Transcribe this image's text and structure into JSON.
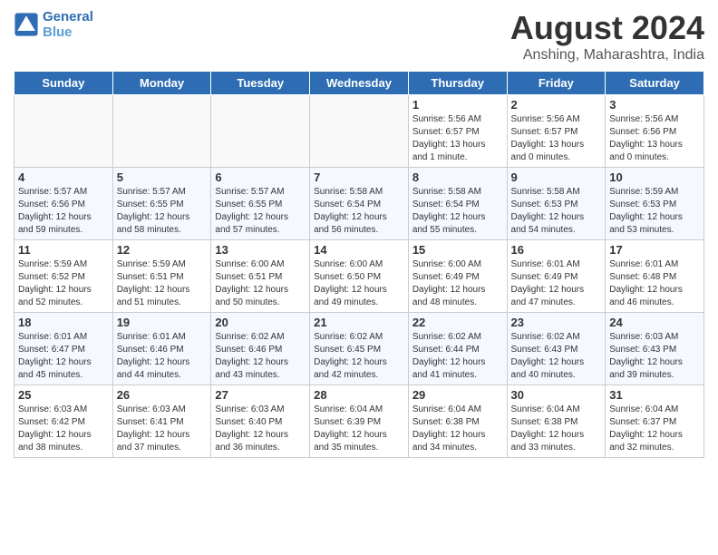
{
  "header": {
    "logo_line1": "General",
    "logo_line2": "Blue",
    "main_title": "August 2024",
    "subtitle": "Anshing, Maharashtra, India"
  },
  "weekdays": [
    "Sunday",
    "Monday",
    "Tuesday",
    "Wednesday",
    "Thursday",
    "Friday",
    "Saturday"
  ],
  "weeks": [
    [
      {
        "day": "",
        "info": ""
      },
      {
        "day": "",
        "info": ""
      },
      {
        "day": "",
        "info": ""
      },
      {
        "day": "",
        "info": ""
      },
      {
        "day": "1",
        "info": "Sunrise: 5:56 AM\nSunset: 6:57 PM\nDaylight: 13 hours\nand 1 minute."
      },
      {
        "day": "2",
        "info": "Sunrise: 5:56 AM\nSunset: 6:57 PM\nDaylight: 13 hours\nand 0 minutes."
      },
      {
        "day": "3",
        "info": "Sunrise: 5:56 AM\nSunset: 6:56 PM\nDaylight: 13 hours\nand 0 minutes."
      }
    ],
    [
      {
        "day": "4",
        "info": "Sunrise: 5:57 AM\nSunset: 6:56 PM\nDaylight: 12 hours\nand 59 minutes."
      },
      {
        "day": "5",
        "info": "Sunrise: 5:57 AM\nSunset: 6:55 PM\nDaylight: 12 hours\nand 58 minutes."
      },
      {
        "day": "6",
        "info": "Sunrise: 5:57 AM\nSunset: 6:55 PM\nDaylight: 12 hours\nand 57 minutes."
      },
      {
        "day": "7",
        "info": "Sunrise: 5:58 AM\nSunset: 6:54 PM\nDaylight: 12 hours\nand 56 minutes."
      },
      {
        "day": "8",
        "info": "Sunrise: 5:58 AM\nSunset: 6:54 PM\nDaylight: 12 hours\nand 55 minutes."
      },
      {
        "day": "9",
        "info": "Sunrise: 5:58 AM\nSunset: 6:53 PM\nDaylight: 12 hours\nand 54 minutes."
      },
      {
        "day": "10",
        "info": "Sunrise: 5:59 AM\nSunset: 6:53 PM\nDaylight: 12 hours\nand 53 minutes."
      }
    ],
    [
      {
        "day": "11",
        "info": "Sunrise: 5:59 AM\nSunset: 6:52 PM\nDaylight: 12 hours\nand 52 minutes."
      },
      {
        "day": "12",
        "info": "Sunrise: 5:59 AM\nSunset: 6:51 PM\nDaylight: 12 hours\nand 51 minutes."
      },
      {
        "day": "13",
        "info": "Sunrise: 6:00 AM\nSunset: 6:51 PM\nDaylight: 12 hours\nand 50 minutes."
      },
      {
        "day": "14",
        "info": "Sunrise: 6:00 AM\nSunset: 6:50 PM\nDaylight: 12 hours\nand 49 minutes."
      },
      {
        "day": "15",
        "info": "Sunrise: 6:00 AM\nSunset: 6:49 PM\nDaylight: 12 hours\nand 48 minutes."
      },
      {
        "day": "16",
        "info": "Sunrise: 6:01 AM\nSunset: 6:49 PM\nDaylight: 12 hours\nand 47 minutes."
      },
      {
        "day": "17",
        "info": "Sunrise: 6:01 AM\nSunset: 6:48 PM\nDaylight: 12 hours\nand 46 minutes."
      }
    ],
    [
      {
        "day": "18",
        "info": "Sunrise: 6:01 AM\nSunset: 6:47 PM\nDaylight: 12 hours\nand 45 minutes."
      },
      {
        "day": "19",
        "info": "Sunrise: 6:01 AM\nSunset: 6:46 PM\nDaylight: 12 hours\nand 44 minutes."
      },
      {
        "day": "20",
        "info": "Sunrise: 6:02 AM\nSunset: 6:46 PM\nDaylight: 12 hours\nand 43 minutes."
      },
      {
        "day": "21",
        "info": "Sunrise: 6:02 AM\nSunset: 6:45 PM\nDaylight: 12 hours\nand 42 minutes."
      },
      {
        "day": "22",
        "info": "Sunrise: 6:02 AM\nSunset: 6:44 PM\nDaylight: 12 hours\nand 41 minutes."
      },
      {
        "day": "23",
        "info": "Sunrise: 6:02 AM\nSunset: 6:43 PM\nDaylight: 12 hours\nand 40 minutes."
      },
      {
        "day": "24",
        "info": "Sunrise: 6:03 AM\nSunset: 6:43 PM\nDaylight: 12 hours\nand 39 minutes."
      }
    ],
    [
      {
        "day": "25",
        "info": "Sunrise: 6:03 AM\nSunset: 6:42 PM\nDaylight: 12 hours\nand 38 minutes."
      },
      {
        "day": "26",
        "info": "Sunrise: 6:03 AM\nSunset: 6:41 PM\nDaylight: 12 hours\nand 37 minutes."
      },
      {
        "day": "27",
        "info": "Sunrise: 6:03 AM\nSunset: 6:40 PM\nDaylight: 12 hours\nand 36 minutes."
      },
      {
        "day": "28",
        "info": "Sunrise: 6:04 AM\nSunset: 6:39 PM\nDaylight: 12 hours\nand 35 minutes."
      },
      {
        "day": "29",
        "info": "Sunrise: 6:04 AM\nSunset: 6:38 PM\nDaylight: 12 hours\nand 34 minutes."
      },
      {
        "day": "30",
        "info": "Sunrise: 6:04 AM\nSunset: 6:38 PM\nDaylight: 12 hours\nand 33 minutes."
      },
      {
        "day": "31",
        "info": "Sunrise: 6:04 AM\nSunset: 6:37 PM\nDaylight: 12 hours\nand 32 minutes."
      }
    ]
  ]
}
